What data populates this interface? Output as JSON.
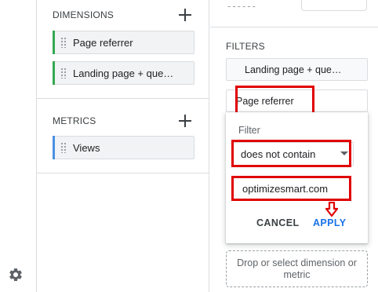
{
  "sidebar": {
    "settings_icon": "gear-icon"
  },
  "dimensions": {
    "heading": "DIMENSIONS",
    "add_icon": "plus-icon",
    "items": [
      {
        "label": "Page referrer",
        "color": "#34a853"
      },
      {
        "label": "Landing page + que…",
        "color": "#34a853"
      }
    ]
  },
  "metrics": {
    "heading": "METRICS",
    "add_icon": "plus-icon",
    "items": [
      {
        "label": "Views",
        "color": "#4a90e2"
      }
    ]
  },
  "top_partial": {
    "dashes": "------"
  },
  "filters": {
    "heading": "FILTERS",
    "items": [
      {
        "label": "Landing page + que…"
      },
      {
        "label": "Page referrer"
      }
    ],
    "popup": {
      "label": "Filter",
      "condition": "does not contain",
      "value": "optimizesmart.com",
      "cancel_label": "CANCEL",
      "apply_label": "APPLY"
    },
    "drop_zone": "Drop or select dimension or metric"
  },
  "colors": {
    "highlight": "#e00000",
    "apply": "#1a73e8",
    "dimension_accent": "#34a853",
    "metric_accent": "#4a90e2"
  }
}
